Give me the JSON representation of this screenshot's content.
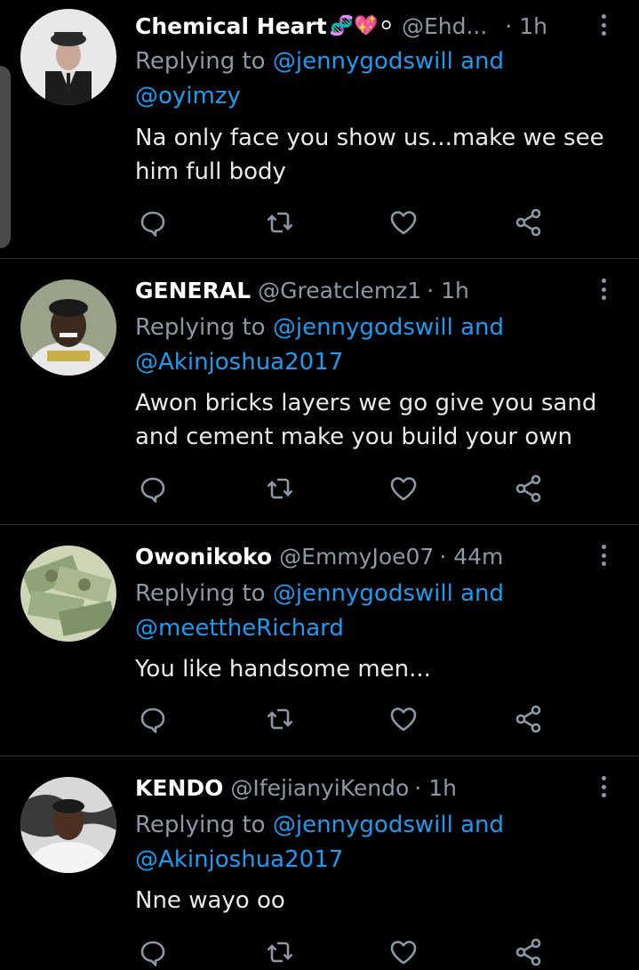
{
  "replying_prefix": "Replying to",
  "and_word": "and",
  "tweets": [
    {
      "name": "Chemical Heart",
      "emojis": "🧬💖⚪",
      "handle": "@Ehd...",
      "time": "· 1h",
      "mention1": "@jennygodswill",
      "mention2": "@oyimzy",
      "text": "Na only face you show us...make we see him full body"
    },
    {
      "name": "GENERAL",
      "emojis": "",
      "handle": "@Greatclemz1",
      "time": "· 1h",
      "mention1": "@jennygodswill",
      "mention2": "@Akinjoshua2017",
      "text": "Awon bricks layers we go give you sand and cement make you build your own"
    },
    {
      "name": "Owonikoko",
      "emojis": "",
      "handle": "@EmmyJoe07",
      "time": "· 44m",
      "mention1": "@jennygodswill",
      "mention2": "@meettheRichard",
      "text": "You like handsome men..."
    },
    {
      "name": "KENDO",
      "emojis": "",
      "handle": "@IfejianyiKendo",
      "time": "· 1h",
      "mention1": "@jennygodswill",
      "mention2": "@Akinjoshua2017",
      "text": "Nne wayo oo"
    }
  ],
  "colors": {
    "background": "#000000",
    "secondary_text": "#8b98a5",
    "link": "#1d9bf0",
    "divider": "#2f3336"
  }
}
